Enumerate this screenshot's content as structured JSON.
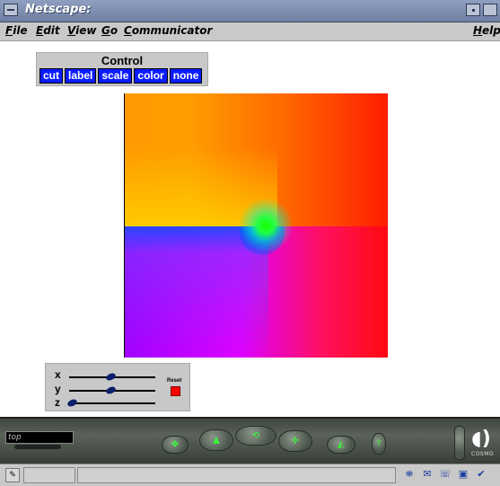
{
  "window": {
    "title": "Netscape:"
  },
  "menu": {
    "file": "File",
    "edit": "Edit",
    "view": "View",
    "go": "Go",
    "communicator": "Communicator",
    "help": "Help"
  },
  "control_panel": {
    "title": "Control",
    "buttons": [
      "cut",
      "label",
      "scale",
      "color",
      "none"
    ],
    "button_color": "#0b1cff"
  },
  "sliders": {
    "x": {
      "label": "x",
      "value": 0.47
    },
    "y": {
      "label": "y",
      "value": 0.47
    },
    "z": {
      "label": "z",
      "value": 0.0
    },
    "reset_label": "Reset",
    "reset_color": "#ff0000"
  },
  "dashboard": {
    "viewpoint_value": "top",
    "brand_logo": "cosmo-logo",
    "brand_label": "COSMO"
  },
  "status": {
    "message": ""
  }
}
